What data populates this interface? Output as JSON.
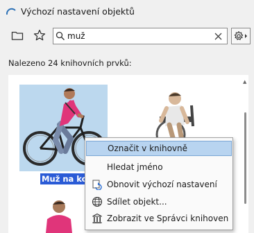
{
  "window": {
    "title": "Výchozí nastavení objektů"
  },
  "toolbar": {
    "icons": [
      "folder-icon",
      "star-icon",
      "search-icon",
      "clear-icon",
      "gear-icon"
    ],
    "search_value": "muž"
  },
  "results": {
    "count_text": "Nalezeno 24 knihovních prvků:"
  },
  "items": [
    {
      "label": "Muž na kole",
      "label_visible": "Muž na kole",
      "selected": true
    },
    {
      "label": "",
      "selected": false
    },
    {
      "label": "",
      "selected": false
    }
  ],
  "context_menu": {
    "items": [
      {
        "label": "Označit v knihovně",
        "highlighted": true
      },
      {
        "label": "Hledat jméno",
        "icon": ""
      },
      {
        "label": "Obnovit výchozí nastavení",
        "icon": "reset-icon"
      },
      {
        "label": "Sdílet objekt...",
        "icon": "share-globe-icon"
      },
      {
        "label": "Zobrazit ve Správci knihoven",
        "icon": "library-manager-icon"
      }
    ]
  },
  "colors": {
    "selection": "#2a5bd6",
    "thumb_selected": "#bcd8ee",
    "menu_highlight": "#b8d4f0"
  }
}
